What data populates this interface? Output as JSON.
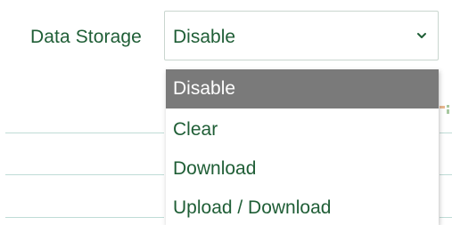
{
  "field": {
    "label": "Data Storage",
    "selected_value": "Disable"
  },
  "dropdown": {
    "options": [
      {
        "label": "Disable",
        "selected": true
      },
      {
        "label": "Clear",
        "selected": false
      },
      {
        "label": "Download",
        "selected": false
      },
      {
        "label": "Upload / Download",
        "selected": false
      }
    ]
  },
  "icons": {
    "chevron": "chevron-down-icon"
  },
  "colors": {
    "text_green": "#1f5e36",
    "highlight": "#7a7a7a",
    "border": "#c9d6cf",
    "row_line": "#bfdcd6"
  }
}
